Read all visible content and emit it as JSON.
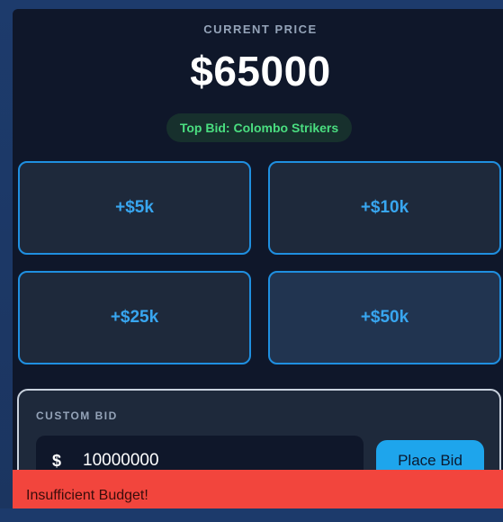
{
  "auction": {
    "current_price_label": "CURRENT PRICE",
    "current_price": "$65000",
    "top_bid": "Top Bid: Colombo Strikers"
  },
  "increments": [
    {
      "label": "+$5k",
      "state": "normal"
    },
    {
      "label": "+$10k",
      "state": "normal"
    },
    {
      "label": "+$25k",
      "state": "normal"
    },
    {
      "label": "+$50k",
      "state": "hover"
    }
  ],
  "custom_bid": {
    "label": "CUSTOM BID",
    "currency_symbol": "$",
    "value": "10000000",
    "button_label": "Place Bid"
  },
  "toast": {
    "message": "Insufficient Budget!",
    "type": "error"
  },
  "colors": {
    "accent": "#1ea5ec",
    "success": "#4ade80",
    "error": "#f2453d",
    "panel_bg": "#0f172a",
    "card_bg": "#1e293b"
  }
}
